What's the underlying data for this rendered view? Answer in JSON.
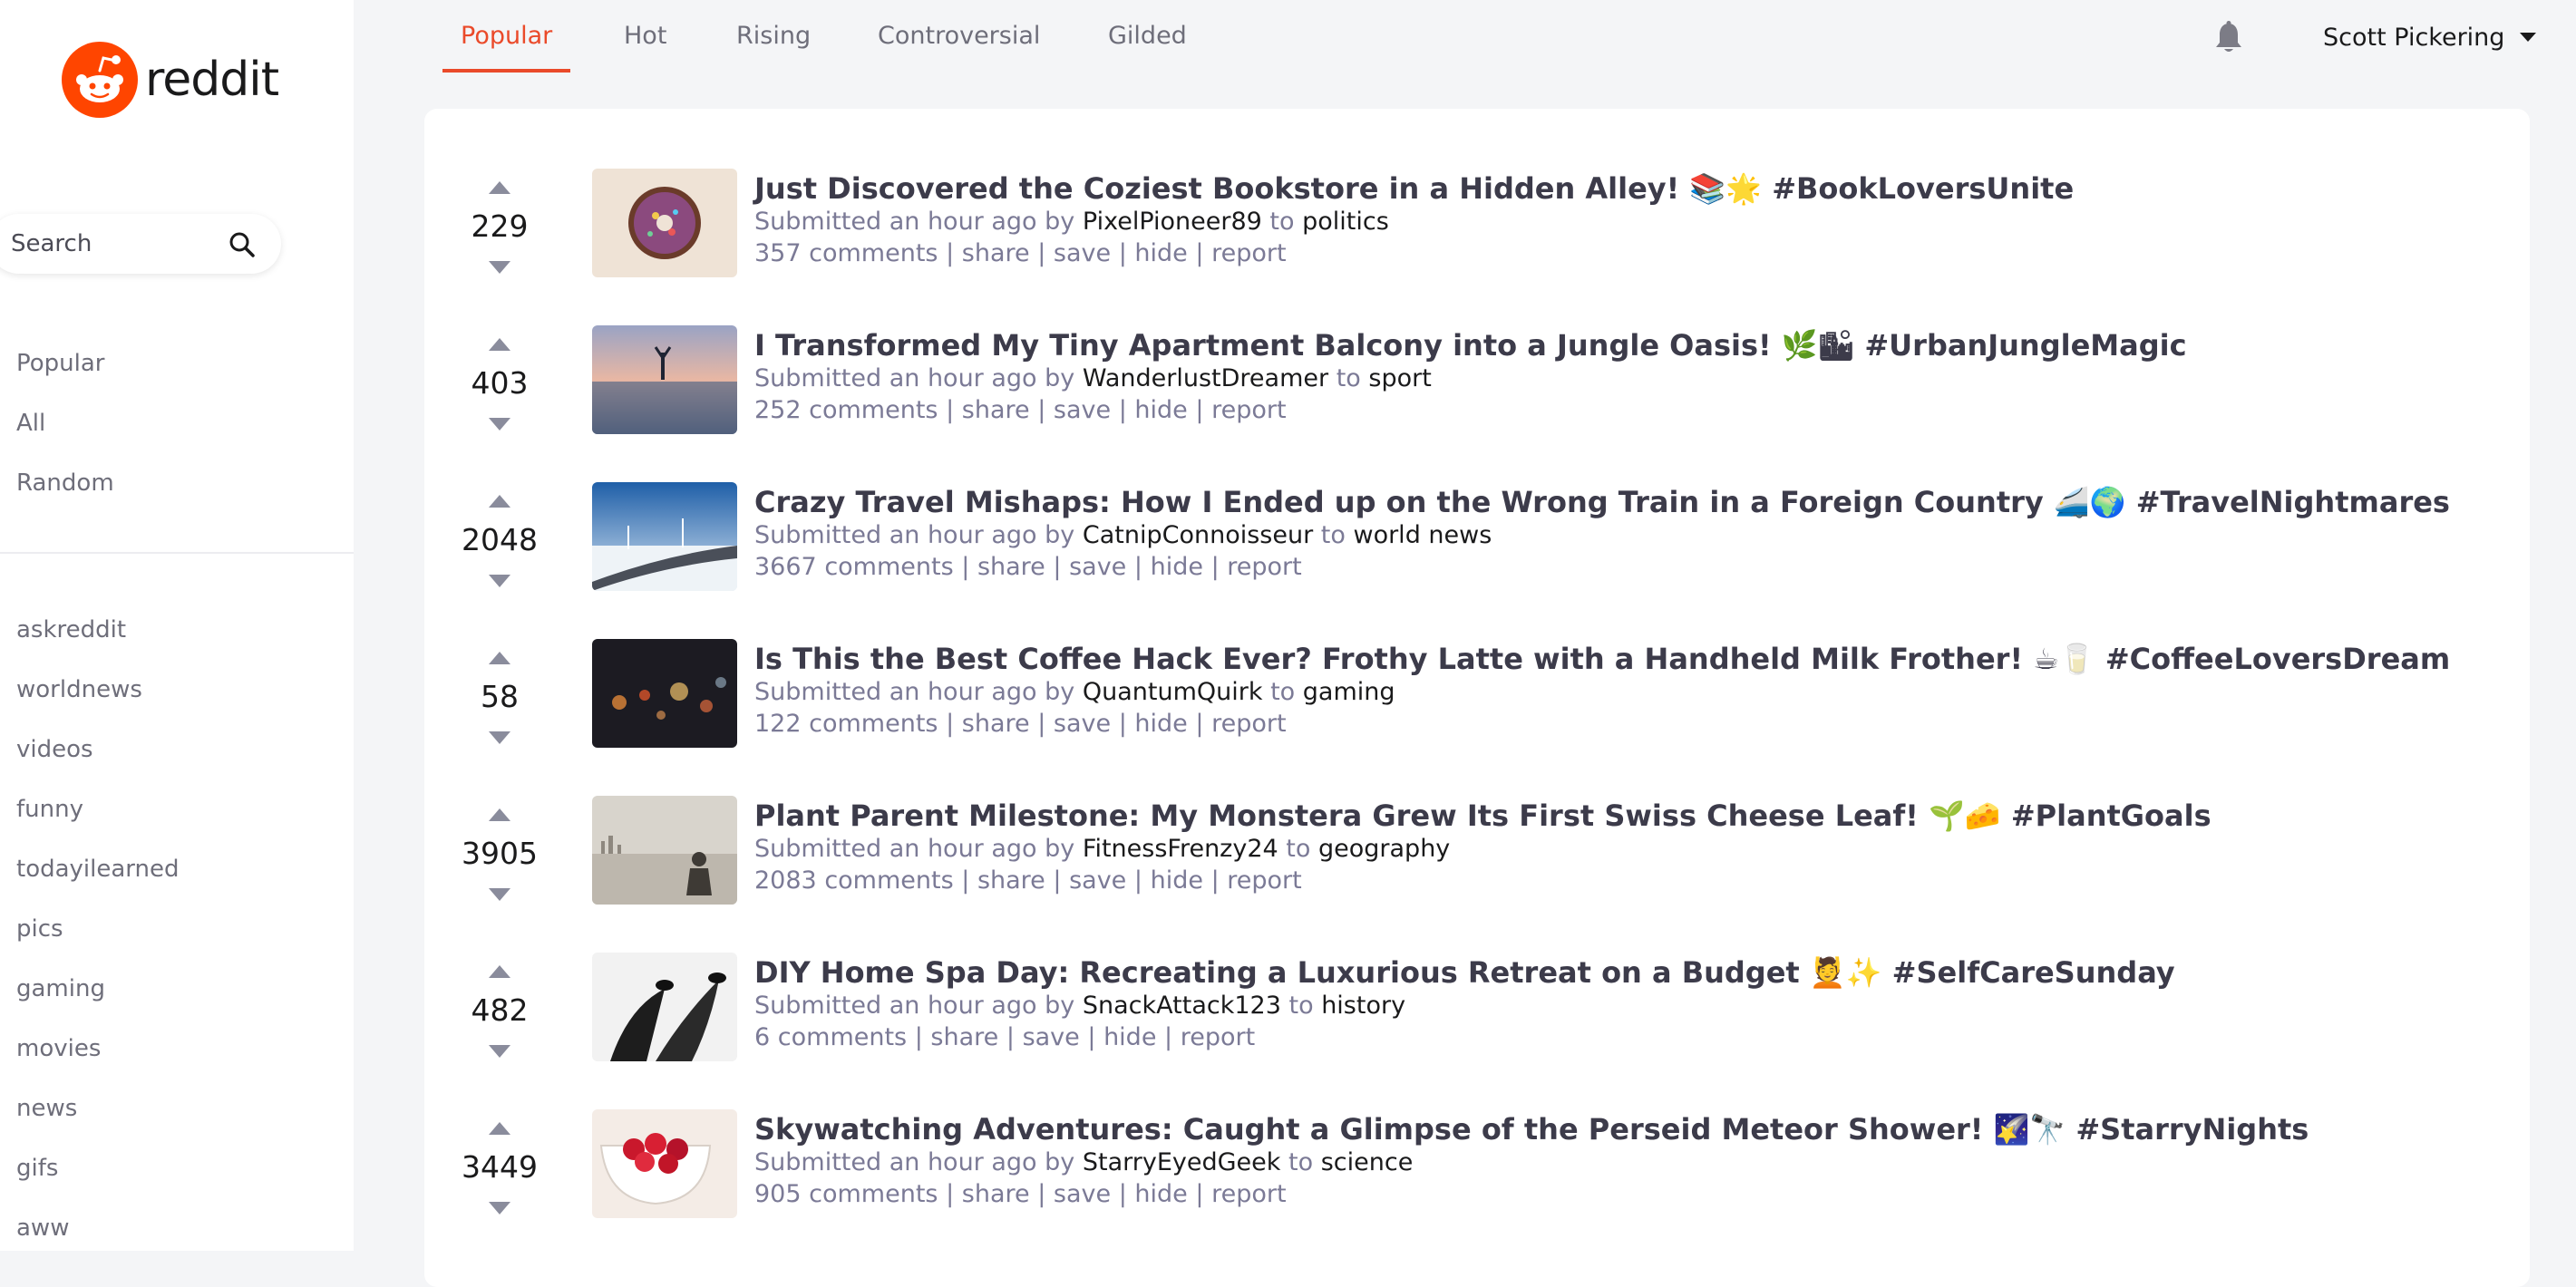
{
  "brand": {
    "name": "reddit"
  },
  "search": {
    "placeholder": "Search"
  },
  "nav": [
    "Popular",
    "All",
    "Random"
  ],
  "subreddits": [
    "askreddit",
    "worldnews",
    "videos",
    "funny",
    "todayilearned",
    "pics",
    "gaming",
    "movies",
    "news",
    "gifs",
    "aww"
  ],
  "tabs": [
    "Popular",
    "Hot",
    "Rising",
    "Controversial",
    "Gilded"
  ],
  "active_tab": "Popular",
  "user": {
    "name": "Scott Pickering"
  },
  "labels": {
    "submitted": "Submitted an hour ago by",
    "to": "to",
    "comments_suffix": "comments",
    "share": "share",
    "save": "save",
    "hide": "hide",
    "report": "report"
  },
  "colors": {
    "accent": "#ea4a2a",
    "text_muted": "#7b7a96",
    "title": "#3c3b4a"
  },
  "posts": [
    {
      "score": "229",
      "title": "Just Discovered the Coziest Bookstore in a Hidden Alley! 📚🌟 #BookLoversUnite",
      "author": "PixelPioneer89",
      "subreddit": "politics",
      "comments": "357",
      "thumb": "donut"
    },
    {
      "score": "403",
      "title": "I Transformed My Tiny Apartment Balcony into a Jungle Oasis! 🌿🏙 #UrbanJungleMagic",
      "author": "WanderlustDreamer",
      "subreddit": "sport",
      "comments": "252",
      "thumb": "lake-sunset"
    },
    {
      "score": "2048",
      "title": "Crazy Travel Mishaps: How I Ended up on the Wrong Train in a Foreign Country 🚄🌍 #TravelNightmares",
      "author": "CatnipConnoisseur",
      "subreddit": "world news",
      "comments": "3667",
      "thumb": "road-windmills"
    },
    {
      "score": "58",
      "title": "Is This the Best Coffee Hack Ever? Frothy Latte with a Handheld Milk Frother! ☕🥛 #CoffeeLoversDream",
      "author": "QuantumQuirk",
      "subreddit": "gaming",
      "comments": "122",
      "thumb": "bokeh-lights"
    },
    {
      "score": "3905",
      "title": "Plant Parent Milestone: My Monstera Grew Its First Swiss Cheese Leaf! 🌱🧀 #PlantGoals",
      "author": "FitnessFrenzy24",
      "subreddit": "geography",
      "comments": "2083",
      "thumb": "person-skyline"
    },
    {
      "score": "482",
      "title": "DIY Home Spa Day: Recreating a Luxurious Retreat on a Budget 💆✨ #SelfCareSunday",
      "author": "SnackAttack123",
      "subreddit": "history",
      "comments": "6",
      "thumb": "feet-bw"
    },
    {
      "score": "3449",
      "title": "Skywatching Adventures: Caught a Glimpse of the Perseid Meteor Shower! 🌠🔭 #StarryNights",
      "author": "StarryEyedGeek",
      "subreddit": "science",
      "comments": "905",
      "thumb": "raspberries"
    }
  ]
}
